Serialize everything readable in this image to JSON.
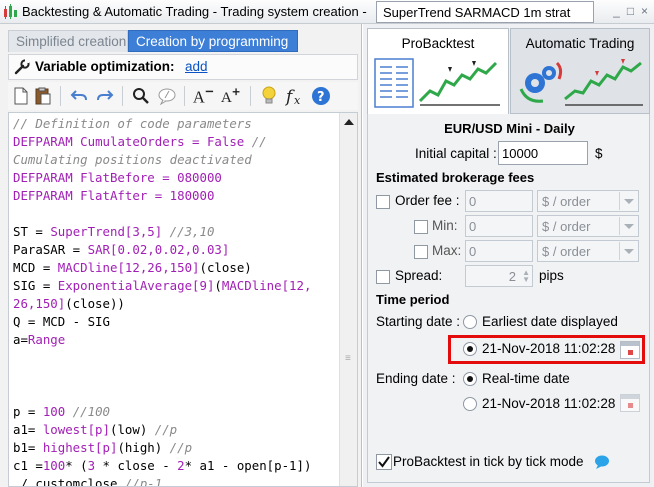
{
  "window": {
    "title": "Backtesting & Automatic Trading - Trading system creation -",
    "system_name": "SuperTrend SARMACD 1m strat",
    "controls": [
      "_",
      "□",
      "×"
    ]
  },
  "left_panel": {
    "tabs": [
      "Simplified creation",
      "Creation by programming"
    ],
    "variable_optimization_label": "Variable optimization:",
    "variable_optimization_link": "add",
    "toolbar_icons": [
      "new-file-icon",
      "paste-icon",
      "undo-icon",
      "redo-icon",
      "search-icon",
      "comment-icon",
      "font-decrease-icon",
      "font-increase-icon",
      "lightbulb-icon",
      "function-icon",
      "help-icon"
    ],
    "code_lines": [
      "// Definition of code parameters",
      "DEFPARAM CumulateOrders = False //",
      "Cumulating positions deactivated",
      "DEFPARAM FlatBefore = 080000",
      "DEFPARAM FlatAfter = 180000",
      "",
      "ST = SuperTrend[3,5] //3,10",
      "ParaSAR = SAR[0.02,0.02,0.03]",
      "MCD = MACDline[12,26,150](close)",
      "SIG = ExponentialAverage[9](MACDline[12,",
      "26,150](close))",
      "Q = MCD - SIG",
      "a=Range",
      "",
      "",
      "",
      "p = 100 //100",
      "a1= lowest[p](low) //p",
      "b1= highest[p](high) //p",
      "c1 =100* (3 * close - 2* a1 - open[p-1])",
      " / customclose //p-1"
    ]
  },
  "right_panel": {
    "tabs": [
      "ProBacktest",
      "Automatic Trading"
    ],
    "instrument": "EUR/USD Mini - Daily",
    "initial_capital_label": "Initial capital :",
    "initial_capital_value": "10000",
    "currency": "$",
    "brokerage_title": "Estimated brokerage fees",
    "order_fee_label": "Order fee :",
    "order_fee_value": "0",
    "order_fee_unit": "$ / order",
    "min_label": "Min:",
    "min_value": "0",
    "min_unit": "$ / order",
    "max_label": "Max:",
    "max_value": "0",
    "max_unit": "$ / order",
    "spread_label": "Spread:",
    "spread_value": "2",
    "spread_unit": "pips",
    "time_period_title": "Time period",
    "starting_date_label": "Starting date :",
    "earliest_date_option": "Earliest date displayed",
    "start_datetime": "21-Nov-2018 11:02:28",
    "ending_date_label": "Ending date :",
    "realtime_option": "Real-time date",
    "end_datetime": "21-Nov-2018 11:02:28",
    "tick_mode_label": "ProBacktest in tick by tick mode",
    "tick_mode_checked": true,
    "highlight_color": "#e30b0b",
    "accent_color": "#3d7fd6"
  }
}
